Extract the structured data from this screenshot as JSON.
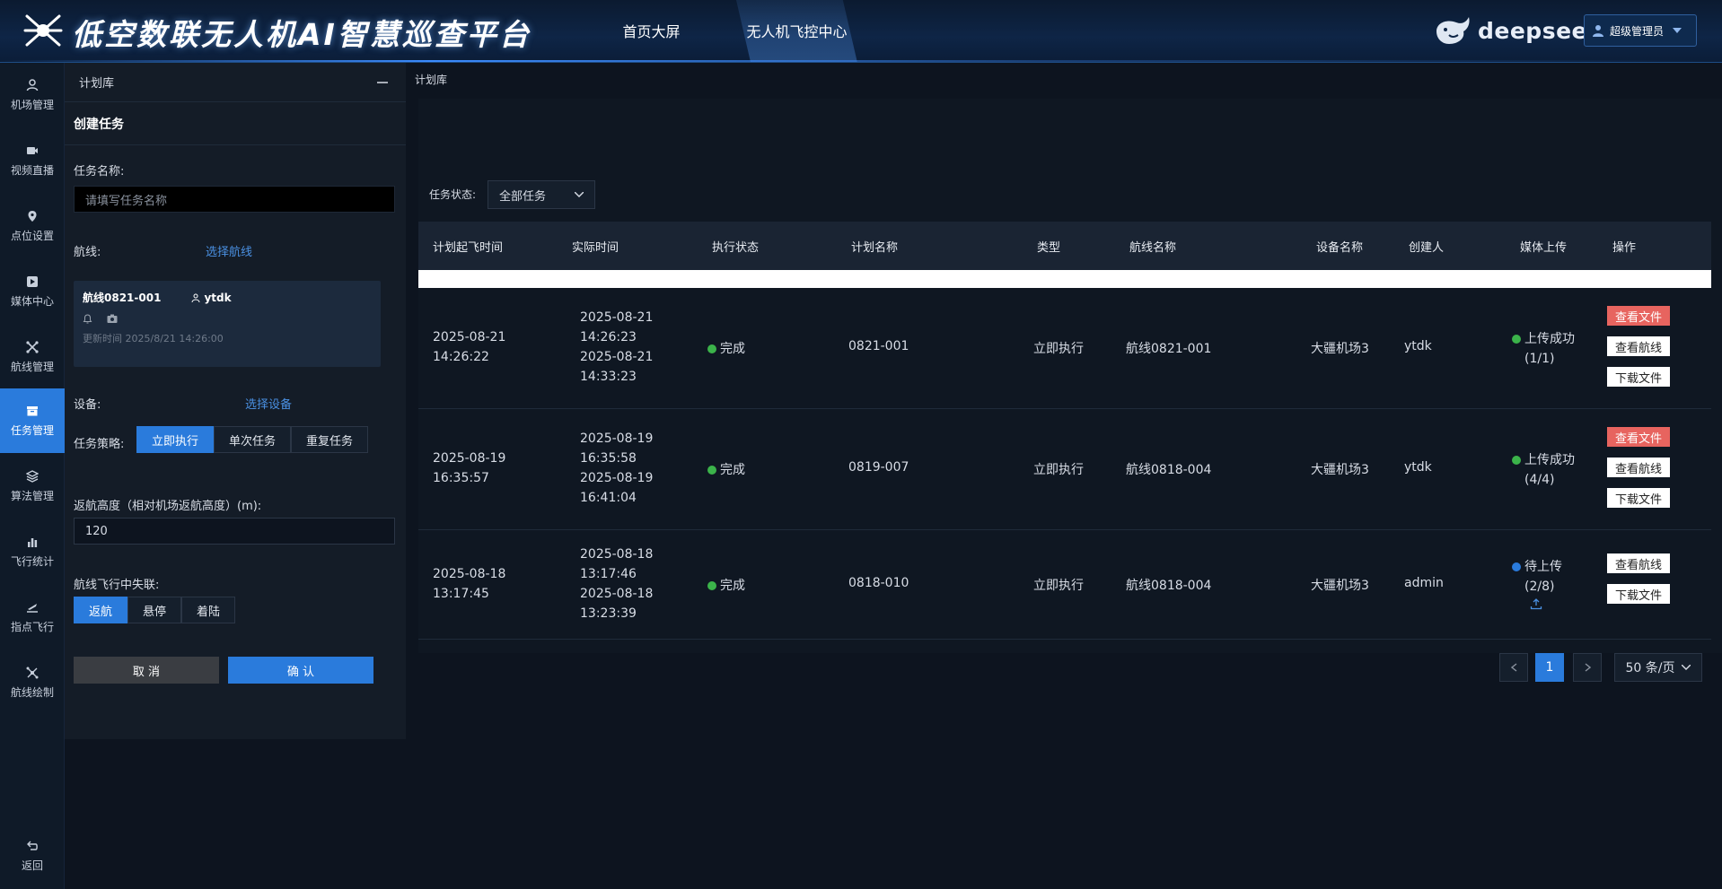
{
  "header": {
    "title": "低空数联无人机AI智慧巡查平台",
    "nav": [
      "首页大屏",
      "无人机飞控中心"
    ],
    "brand": "deepseek",
    "user": "超级管理员"
  },
  "rail": [
    {
      "label": "机场管理",
      "icon": "user-icon"
    },
    {
      "label": "视频直播",
      "icon": "video-icon"
    },
    {
      "label": "点位设置",
      "icon": "pin-icon"
    },
    {
      "label": "媒体中心",
      "icon": "media-icon"
    },
    {
      "label": "航线管理",
      "icon": "route-icon"
    },
    {
      "label": "任务管理",
      "icon": "task-icon"
    },
    {
      "label": "算法管理",
      "icon": "layers-icon"
    },
    {
      "label": "飞行统计",
      "icon": "chart-icon"
    },
    {
      "label": "指点飞行",
      "icon": "flight-icon"
    },
    {
      "label": "航线绘制",
      "icon": "draw-icon"
    }
  ],
  "back": "返回",
  "panel": {
    "title": "计划库",
    "create_title": "创建任务",
    "name_label": "任务名称:",
    "name_placeholder": "请填写任务名称",
    "route_label": "航线:",
    "route_link": "选择航线",
    "route_card": {
      "name": "航线0821-001",
      "owner": "ytdk",
      "updated": "更新时间 2025/8/21 14:26:00"
    },
    "device_label": "设备:",
    "device_link": "选择设备",
    "strategy_label": "任务策略:",
    "strategy": [
      "立即执行",
      "单次任务",
      "重复任务"
    ],
    "height_label": "返航高度（相对机场返航高度）(m):",
    "height_value": "120",
    "lost_label": "航线飞行中失联:",
    "lost": [
      "返航",
      "悬停",
      "着陆"
    ],
    "cancel": "取 消",
    "confirm": "确 认"
  },
  "main": {
    "breadcrumb": "计划库",
    "filter_label": "任务状态:",
    "filter_value": "全部任务",
    "columns": [
      "计划起飞时间",
      "实际时间",
      "执行状态",
      "计划名称",
      "类型",
      "航线名称",
      "设备名称",
      "创建人",
      "媒体上传",
      "操作"
    ],
    "rows": [
      {
        "plan_date": "2025-08-21",
        "plan_time": "14:26:22",
        "actual": [
          "2025-08-21",
          "14:26:23",
          "2025-08-21",
          "14:33:23"
        ],
        "status": "完成",
        "name": "0821-001",
        "type": "立即执行",
        "route": "航线0821-001",
        "device": "大疆机场3",
        "creator": "ytdk",
        "upload": "上传成功",
        "upload_count": "(1/1)",
        "ops": [
          "查看文件",
          "查看航线",
          "下载文件"
        ]
      },
      {
        "plan_date": "2025-08-19",
        "plan_time": "16:35:57",
        "actual": [
          "2025-08-19",
          "16:35:58",
          "2025-08-19",
          "16:41:04"
        ],
        "status": "完成",
        "name": "0819-007",
        "type": "立即执行",
        "route": "航线0818-004",
        "device": "大疆机场3",
        "creator": "ytdk",
        "upload": "上传成功",
        "upload_count": "(4/4)",
        "ops": [
          "查看文件",
          "查看航线",
          "下载文件"
        ]
      },
      {
        "plan_date": "2025-08-18",
        "plan_time": "13:17:45",
        "actual": [
          "2025-08-18",
          "13:17:46",
          "2025-08-18",
          "13:23:39"
        ],
        "status": "完成",
        "name": "0818-010",
        "type": "立即执行",
        "route": "航线0818-004",
        "device": "大疆机场3",
        "creator": "admin",
        "upload": "待上传",
        "upload_count": "(2/8)",
        "ops": [
          "查看航线",
          "下载文件"
        ]
      }
    ],
    "pagination": {
      "page": "1",
      "size": "50 条/页"
    }
  },
  "colors": {
    "accent": "#2a7bdc",
    "success": "#3bb34a",
    "pending": "#2a7bdc",
    "danger": "#e7645f"
  }
}
